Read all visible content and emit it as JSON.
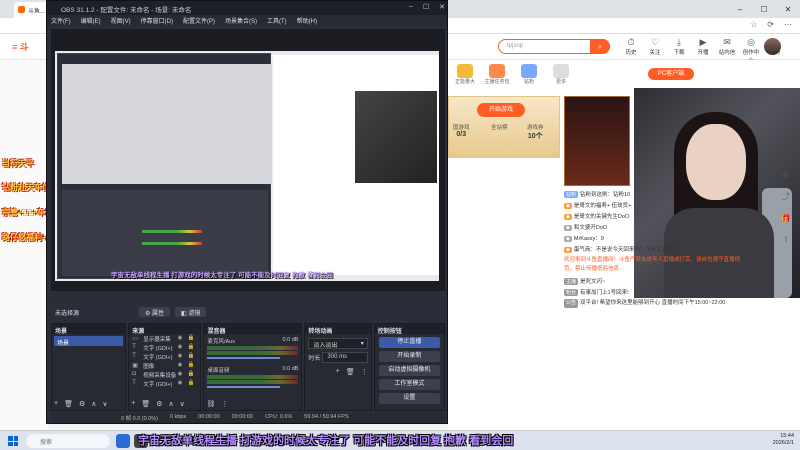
{
  "browser": {
    "tab_label": "斗鱼…",
    "toolbar_icons": [
      "☆",
      "⟳",
      "⋯"
    ]
  },
  "site": {
    "search_placeholder": "tpjsnp",
    "nav": [
      {
        "icon": "⏱",
        "label": "历史"
      },
      {
        "icon": "♡",
        "label": "关注"
      },
      {
        "icon": "⤓",
        "label": "下载"
      },
      {
        "icon": "▶",
        "label": "开播"
      },
      {
        "icon": "✉",
        "label": "站内信"
      },
      {
        "icon": "◎",
        "label": "创作中心"
      },
      {
        "icon": "✓",
        "label": "任务"
      }
    ],
    "left_gifts": [
      "当行天平",
      "钻粉赴天车位+钻粉群",
      "宗管+□□+车位",
      "路仔怒福利+以上"
    ],
    "gift_row": [
      "正能量大",
      "主播任务包",
      "钻粉",
      "更多"
    ],
    "pc_client": "PC客户端",
    "game_banner": {
      "button": "开始游戏",
      "stats": [
        {
          "label": "国游戏",
          "value": "0/3"
        },
        {
          "label": "全站榜",
          "value": ""
        },
        {
          "label": "游戏券",
          "value": "10个"
        }
      ]
    },
    "chat": [
      {
        "badge": "钻粉",
        "color": "#7aa7ff",
        "text": "钻粉到这刷：钻粉10"
      },
      {
        "badge": "",
        "color": "#ff9b3a",
        "text": "是哥文的福寿+ 伍玫贡+"
      },
      {
        "badge": "",
        "color": "#ff9b3a",
        "text": "是哥文的关键先生DoO"
      },
      {
        "badge": "",
        "color": "#aaaaaa",
        "text": "和文婆开DoO"
      },
      {
        "badge": "",
        "color": "#aaaaaa",
        "text": "MrKassy：9"
      },
      {
        "badge": "",
        "color": "#ff9b3a",
        "text": "蛋气商：不是说今天回来吗？今天又咸了？"
      }
    ],
    "notice": "欢迎来到斗鱼直播间！斗鱼严禁未成年人直播或打赏，请自觉遵守直播规范，禁止传播低俗信息…",
    "host_info": [
      {
        "label": "主播",
        "value": "是死文闪~"
      },
      {
        "label": "粉丝",
        "value": "有事加门上1号回来!"
      },
      {
        "label": "公告",
        "value": "双平台! 希望你来这里能够到开心 直播时间下午15:00~22:00"
      }
    ]
  },
  "obs": {
    "title": "OBS 31.1.2 - 配置文件: 未命名 - 场景: 未命名",
    "menu": [
      "文件(F)",
      "编辑(E)",
      "视图(V)",
      "停靠窗口(D)",
      "配置文件(P)",
      "场景集合(S)",
      "工具(T)",
      "帮助(H)"
    ],
    "preview_subtitle": "宇宙无敌单线程生播 打游戏的时候太专注了 可能不能及时回复 抱歉 看到会回",
    "scene_bar": {
      "label": "未选择源",
      "props": "属性",
      "filters": "滤镜"
    },
    "docks": {
      "scenes": {
        "title": "场景",
        "items": [
          "场景"
        ]
      },
      "sources": {
        "title": "来源",
        "items": [
          "显示器采集",
          "文字 (GDI+)",
          "文字 (GDI+)",
          "图像",
          "视频采集设备",
          "文字 (GDI+)"
        ]
      },
      "mixer": {
        "title": "混音器",
        "channels": [
          {
            "name": "麦克风/Aux",
            "db": "0.0 dB"
          },
          {
            "name": "桌面音频",
            "db": "0.0 dB"
          }
        ]
      },
      "transitions": {
        "title": "转场动画",
        "type": "淡入淡出",
        "duration_label": "时长",
        "duration": "300 ms"
      },
      "controls": {
        "title": "控制按钮",
        "buttons": [
          "停止直播",
          "开始录制",
          "启动虚拟摄像机",
          "工作室模式",
          "设置"
        ]
      }
    },
    "status": [
      "0 帧 0.0 (0.0%)",
      "0 kbps",
      "00:00:00",
      "00:00:00",
      "CPU: 0.6%",
      "59.94 / 59.94 FPS"
    ]
  },
  "taskbar": {
    "search": "搜索",
    "time": "15:44",
    "date": "2026/2/1"
  },
  "main_subtitle": "宇宙无敌单线程生播 打游戏的时候太专注了 可能不能及时回复 抱歉 看到会回"
}
